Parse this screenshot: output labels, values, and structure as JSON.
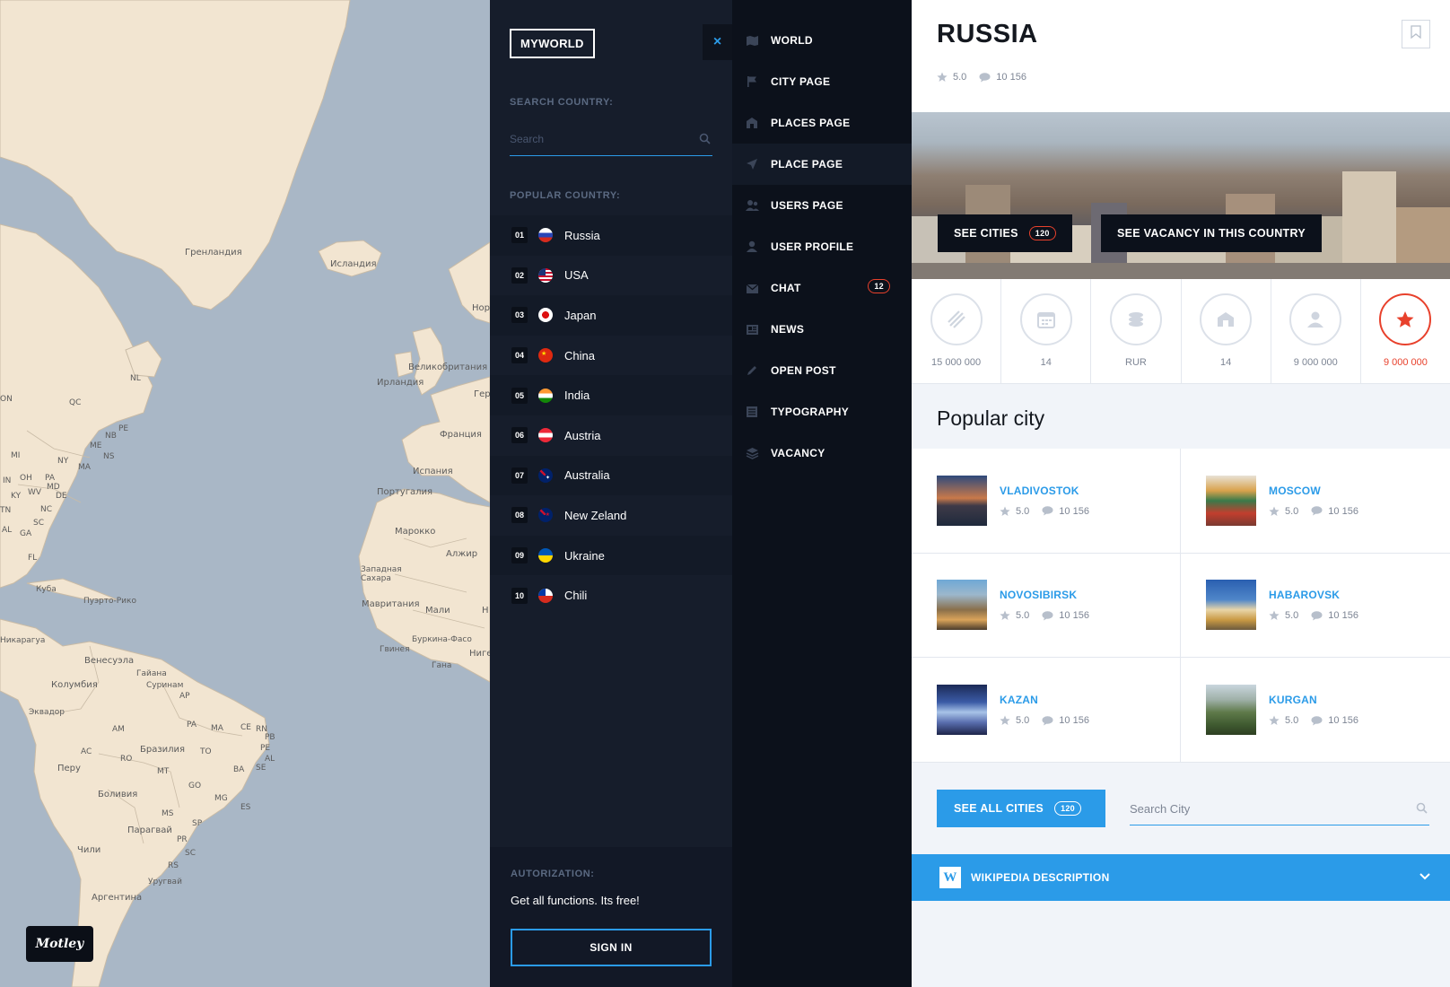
{
  "map": {
    "labels": [
      "Гренландия",
      "Исландия",
      "Нор",
      "Великобритания",
      "Ирландия",
      "Гер",
      "Франция",
      "Испания",
      "Португалия",
      "Марокко",
      "Алжир",
      "Западная Сахара",
      "Мавритания",
      "Мали",
      "Н",
      "Буркина-Фасо",
      "Гвинея",
      "Гана",
      "Нигер",
      "Куба",
      "Пуэрто-Рико",
      "Никарагуа",
      "Венесуэла",
      "Гайана",
      "Суринам",
      "Колумбия",
      "Эквадор",
      "Перу",
      "Бразилия",
      "Боливия",
      "Парагвай",
      "Уругвай",
      "Чили",
      "Аргентина",
      "ON",
      "QC",
      "NL",
      "NB",
      "PE",
      "NS",
      "ME",
      "MI",
      "NY",
      "MA",
      "IN",
      "OH",
      "PA",
      "KY",
      "WV",
      "MD",
      "DE",
      "NC",
      "TN",
      "SC",
      "AL",
      "GA",
      "FL",
      "AP",
      "AM",
      "PA",
      "MA",
      "CE",
      "RN",
      "PB",
      "PE",
      "AL",
      "SE",
      "BA",
      "TO",
      "RO",
      "MT",
      "GO",
      "AC",
      "MG",
      "ES",
      "MS",
      "SP",
      "PR",
      "SC",
      "RS"
    ],
    "logo_text": "Motley"
  },
  "sidebar": {
    "brand": "MYWORLD",
    "close_icon": "×",
    "search_label": "SEARCH COUNTRY:",
    "search_placeholder": "Search",
    "popular_label": "POPULAR COUNTRY:",
    "countries": [
      {
        "num": "01",
        "name": "Russia"
      },
      {
        "num": "02",
        "name": "USA"
      },
      {
        "num": "03",
        "name": "Japan"
      },
      {
        "num": "04",
        "name": "China"
      },
      {
        "num": "05",
        "name": "India"
      },
      {
        "num": "06",
        "name": "Austria"
      },
      {
        "num": "07",
        "name": "Australia"
      },
      {
        "num": "08",
        "name": "New Zeland"
      },
      {
        "num": "09",
        "name": "Ukraine"
      },
      {
        "num": "10",
        "name": "Chili"
      }
    ],
    "auth_label": "AUTORIZATION:",
    "auth_text": "Get all functions. Its free!",
    "signin": "SIGN IN"
  },
  "nav": {
    "items": [
      {
        "label": "WORLD",
        "icon": "map-icon"
      },
      {
        "label": "CITY PAGE",
        "icon": "flag-icon"
      },
      {
        "label": "PLACES PAGE",
        "icon": "building-icon"
      },
      {
        "label": "PLACE PAGE",
        "icon": "navigation-arrow-icon"
      },
      {
        "label": "USERS PAGE",
        "icon": "users-icon"
      },
      {
        "label": "USER PROFILE",
        "icon": "user-icon"
      },
      {
        "label": "CHAT",
        "icon": "envelope-icon",
        "badge": "12"
      },
      {
        "label": "NEWS",
        "icon": "newspaper-icon"
      },
      {
        "label": "OPEN POST",
        "icon": "pencil-icon"
      },
      {
        "label": "TYPOGRAPHY",
        "icon": "text-lines-icon"
      },
      {
        "label": "VACANCY",
        "icon": "stack-icon"
      }
    ]
  },
  "country": {
    "title": "RUSSIA",
    "rating": "5.0",
    "comments": "10 156",
    "see_cities": "SEE CITIES",
    "see_cities_count": "120",
    "see_vacancy": "SEE VACANCY IN THIS COUNTRY",
    "stats": [
      {
        "value": "15 000 000",
        "icon": "area-icon"
      },
      {
        "value": "14",
        "icon": "calendar-icon"
      },
      {
        "value": "RUR",
        "icon": "coins-icon"
      },
      {
        "value": "14",
        "icon": "house-icon"
      },
      {
        "value": "9 000 000",
        "icon": "population-icon"
      },
      {
        "value": "9 000 000",
        "icon": "star-icon"
      }
    ]
  },
  "popular": {
    "title": "Popular city",
    "cities": [
      {
        "name": "VLADIVOSTOK",
        "rating": "5.0",
        "comments": "10 156"
      },
      {
        "name": "MOSCOW",
        "rating": "5.0",
        "comments": "10 156"
      },
      {
        "name": "NOVOSIBIRSK",
        "rating": "5.0",
        "comments": "10 156"
      },
      {
        "name": "HABAROVSK",
        "rating": "5.0",
        "comments": "10 156"
      },
      {
        "name": "KAZAN",
        "rating": "5.0",
        "comments": "10 156"
      },
      {
        "name": "KURGAN",
        "rating": "5.0",
        "comments": "10 156"
      }
    ],
    "see_all": "SEE ALL CITIES",
    "see_all_count": "120",
    "search_placeholder": "Search City"
  },
  "wiki": {
    "logo": "W",
    "label": "WIKIPEDIA DESCRIPTION"
  },
  "colors": {
    "accent": "#2b9be8",
    "alert": "#e8412c",
    "dark": "#0c111b",
    "panel": "#161d2b"
  }
}
